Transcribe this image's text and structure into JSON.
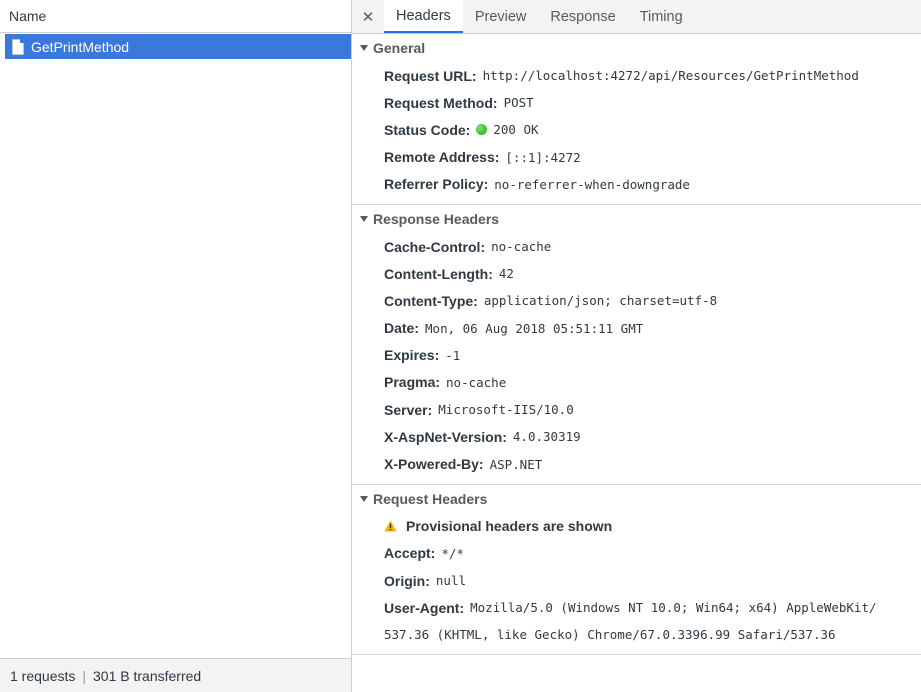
{
  "left": {
    "header": "Name",
    "requests": [
      {
        "name": "GetPrintMethod",
        "selected": true
      }
    ],
    "status": {
      "requests": "1 requests",
      "separator": "|",
      "transferred": "301 B transferred"
    }
  },
  "tabs": {
    "close": "✕",
    "items": [
      "Headers",
      "Preview",
      "Response",
      "Timing"
    ],
    "active": "Headers"
  },
  "general": {
    "title": "General",
    "rows": [
      {
        "key": "Request URL:",
        "value": "http://localhost:4272/api/Resources/GetPrintMethod"
      },
      {
        "key": "Request Method:",
        "value": "POST"
      },
      {
        "key": "Status Code:",
        "value": "200 OK"
      },
      {
        "key": "Remote Address:",
        "value": "[::1]:4272"
      },
      {
        "key": "Referrer Policy:",
        "value": "no-referrer-when-downgrade"
      }
    ]
  },
  "response_headers": {
    "title": "Response Headers",
    "rows": [
      {
        "key": "Cache-Control:",
        "value": "no-cache"
      },
      {
        "key": "Content-Length:",
        "value": "42"
      },
      {
        "key": "Content-Type:",
        "value": "application/json; charset=utf-8"
      },
      {
        "key": "Date:",
        "value": "Mon, 06 Aug 2018 05:51:11 GMT"
      },
      {
        "key": "Expires:",
        "value": "-1"
      },
      {
        "key": "Pragma:",
        "value": "no-cache"
      },
      {
        "key": "Server:",
        "value": "Microsoft-IIS/10.0"
      },
      {
        "key": "X-AspNet-Version:",
        "value": "4.0.30319"
      },
      {
        "key": "X-Powered-By:",
        "value": "ASP.NET"
      }
    ]
  },
  "request_headers": {
    "title": "Request Headers",
    "warning": "Provisional headers are shown",
    "rows": [
      {
        "key": "Accept:",
        "value": "*/*"
      },
      {
        "key": "Origin:",
        "value": "null"
      },
      {
        "key": "User-Agent:",
        "value": "Mozilla/5.0 (Windows NT 10.0; Win64; x64) AppleWebKit/"
      }
    ],
    "user_agent_continuation": "537.36 (KHTML, like Gecko) Chrome/67.0.3396.99 Safari/537.36"
  },
  "colors": {
    "selection": "#3879d9",
    "tab_underline": "#1a73e8",
    "status_ok": "#1aa51a",
    "warning": "#f4b400"
  },
  "icons": {
    "status": "green-dot-icon",
    "warning": "warning-triangle-icon",
    "file": "document-icon",
    "collapse": "triangle-down-icon",
    "close": "close-icon"
  }
}
